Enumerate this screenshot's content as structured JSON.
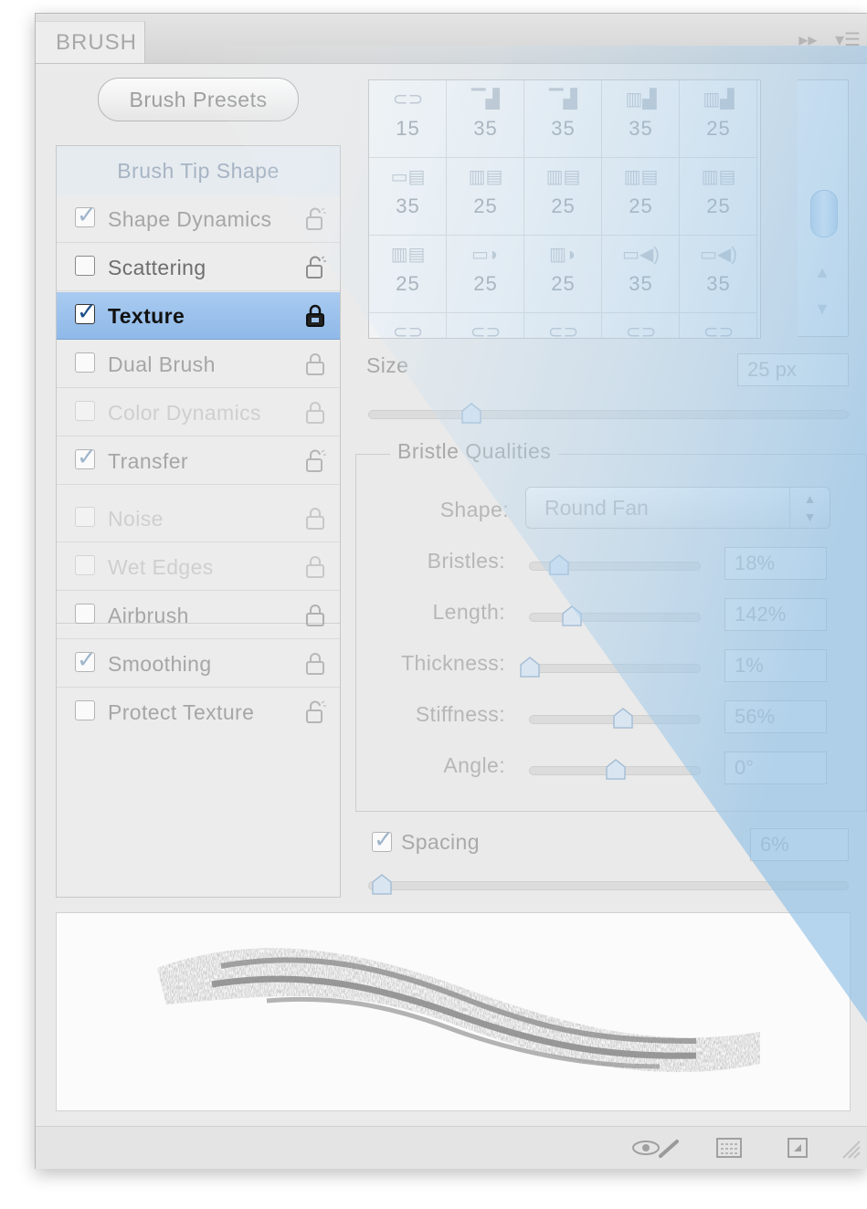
{
  "panel": {
    "tab_label": "BRUSH",
    "collapse_icon": "double-chevron-right-icon",
    "menu_icon": "panel-menu-icon",
    "presets_button": "Brush Presets"
  },
  "options": {
    "header": "Brush Tip Shape",
    "items": [
      {
        "label": "Shape Dynamics",
        "checked": true
      },
      {
        "label": "Scattering",
        "checked": false
      },
      {
        "label": "Texture",
        "checked": true
      },
      {
        "label": "Dual Brush",
        "checked": false
      },
      {
        "label": "Color Dynamics",
        "checked": false
      },
      {
        "label": "Transfer",
        "checked": true
      },
      {
        "label": "Noise",
        "checked": false
      },
      {
        "label": "Wet Edges",
        "checked": false
      },
      {
        "label": "Airbrush",
        "checked": false
      },
      {
        "label": "Smoothing",
        "checked": true
      },
      {
        "label": "Protect Texture",
        "checked": false
      }
    ]
  },
  "brush_tips": {
    "row1": [
      "15",
      "35",
      "35",
      "35",
      "25"
    ],
    "row2": [
      "35",
      "25",
      "25",
      "25",
      "25"
    ],
    "row3": [
      "25",
      "25",
      "25",
      "35",
      "35"
    ]
  },
  "size": {
    "label": "Size",
    "value": "25 px"
  },
  "bristle": {
    "title": "Bristle Qualities",
    "shape_label": "Shape:",
    "shape_value": "Round Fan",
    "bristles_label": "Bristles:",
    "bristles_value": "18%",
    "length_label": "Length:",
    "length_value": "142%",
    "thickness_label": "Thickness:",
    "thickness_value": "1%",
    "stiffness_label": "Stiffness:",
    "stiffness_value": "56%",
    "angle_label": "Angle:",
    "angle_value": "0°"
  },
  "spacing": {
    "label": "Spacing",
    "value": "6%",
    "checked": true
  },
  "colors": {
    "selection": "#9dc3ee",
    "sweep": "#b8d7ee"
  }
}
